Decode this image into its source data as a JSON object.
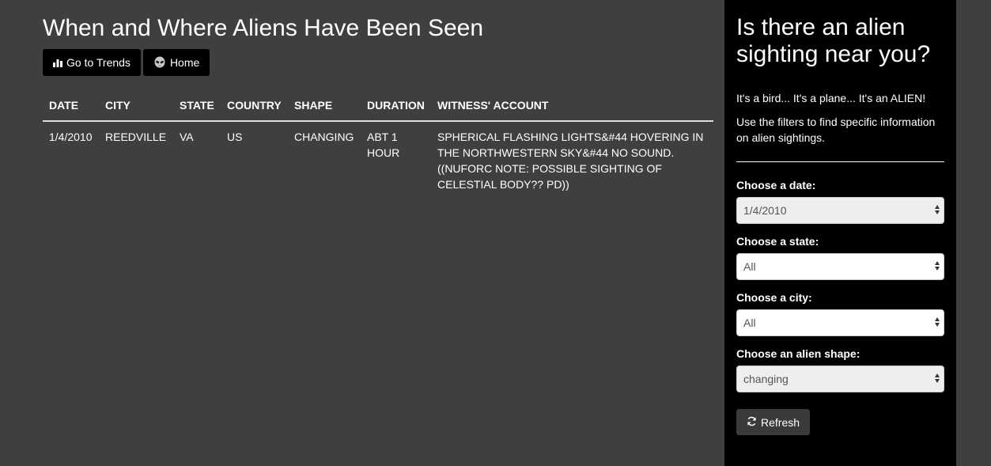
{
  "page": {
    "title": "When and Where Aliens Have Been Seen"
  },
  "buttons": {
    "trends_label": "Go to Trends",
    "home_label": "Home"
  },
  "table": {
    "headers": [
      "DATE",
      "CITY",
      "STATE",
      "COUNTRY",
      "SHAPE",
      "DURATION",
      "WITNESS' ACCOUNT"
    ],
    "rows": [
      [
        "1/4/2010",
        "REEDVILLE",
        "VA",
        "US",
        "CHANGING",
        "ABT 1 HOUR",
        "SPHERICAL FLASHING LIGHTS&#44 HOVERING IN THE NORTHWESTERN SKY&#44 NO SOUND. ((NUFORC NOTE: POSSIBLE SIGHTING OF CELESTIAL BODY?? PD))"
      ]
    ]
  },
  "sidebar": {
    "title": "Is there an alien sighting near you?",
    "intro": "It's a bird... It's a plane... It's an ALIEN!",
    "instructions": "Use the filters to find specific information on alien sightings.",
    "filters": [
      {
        "label": "Choose a date:",
        "value": "1/4/2010",
        "disabled": true
      },
      {
        "label": "Choose a state:",
        "value": "All",
        "disabled": false
      },
      {
        "label": "Choose a city:",
        "value": "All",
        "disabled": false
      },
      {
        "label": "Choose an alien shape:",
        "value": "changing",
        "disabled": true
      }
    ],
    "refresh_label": "Refresh"
  },
  "icons": {
    "trends": "bar-chart-icon",
    "home": "alien-icon",
    "refresh": "refresh-icon"
  },
  "colors": {
    "background": "#3f3f3f",
    "sidebar": "#000000",
    "button": "#000000",
    "refresh_button": "#3a3a3a"
  }
}
